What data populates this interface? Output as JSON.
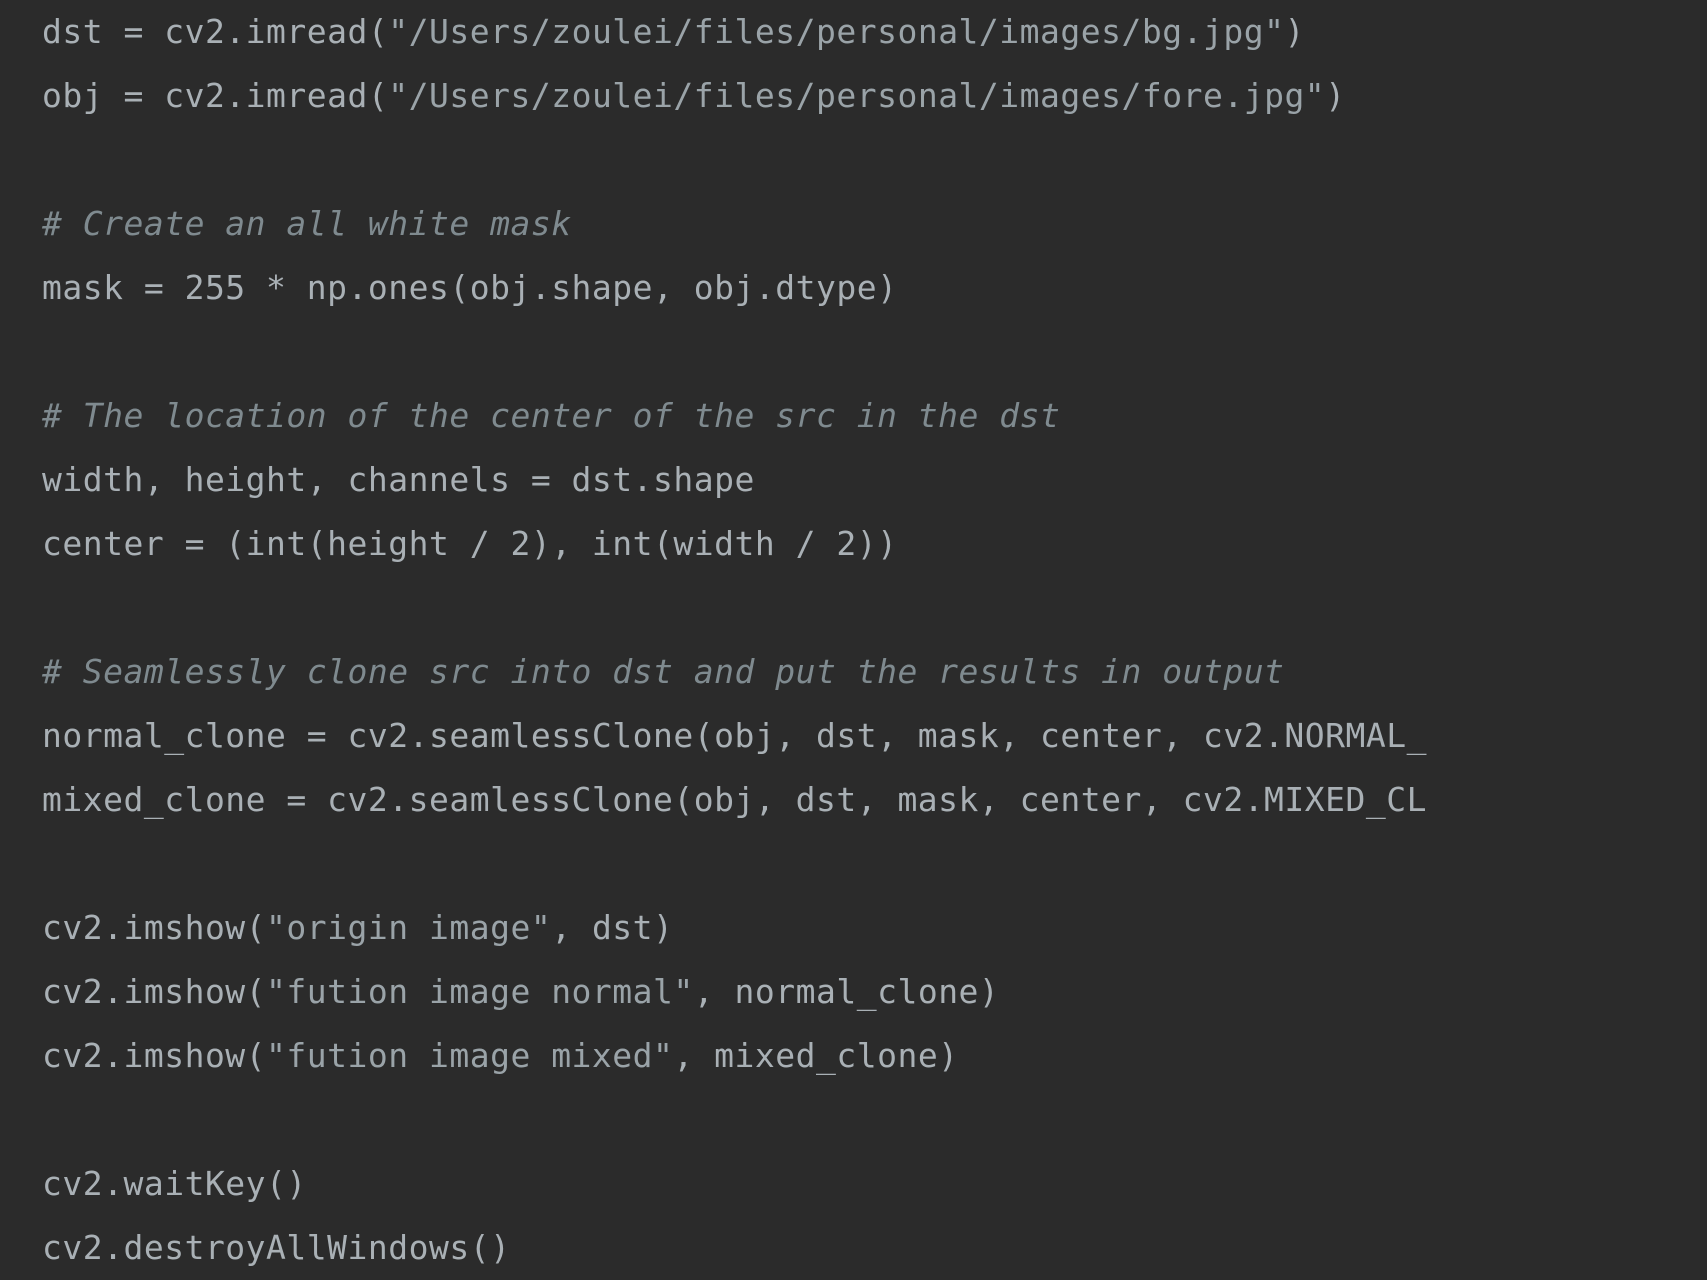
{
  "code": {
    "line1_a": "dst = cv2.imread(",
    "line1_str": "\"/Users/zoulei/files/personal/images/bg.jpg\"",
    "line1_b": ")",
    "line2_a": "obj = cv2.imread(",
    "line2_str": "\"/Users/zoulei/files/personal/images/fore.jpg\"",
    "line2_b": ")",
    "line3_blank": "",
    "line4_comment": "# Create an all white mask",
    "line5": "mask = 255 * np.ones(obj.shape, obj.dtype)",
    "line6_blank": "",
    "line7_comment": "# The location of the center of the src in the dst",
    "line8": "width, height, channels = dst.shape",
    "line9": "center = (int(height / 2), int(width / 2))",
    "line10_blank": "",
    "line11_comment": "# Seamlessly clone src into dst and put the results in output",
    "line12": "normal_clone = cv2.seamlessClone(obj, dst, mask, center, cv2.NORMAL_",
    "line13": "mixed_clone = cv2.seamlessClone(obj, dst, mask, center, cv2.MIXED_CL",
    "line14_blank": "",
    "line15_a": "cv2.imshow(",
    "line15_str": "\"origin image\"",
    "line15_b": ", dst)",
    "line16_a": "cv2.imshow(",
    "line16_str": "\"fution image normal\"",
    "line16_b": ", normal_clone)",
    "line17_a": "cv2.imshow(",
    "line17_str": "\"fution image mixed\"",
    "line17_b": ", mixed_clone)",
    "line18_blank": "",
    "line19": "cv2.waitKey()",
    "line20": "cv2.destroyAllWindows()"
  }
}
